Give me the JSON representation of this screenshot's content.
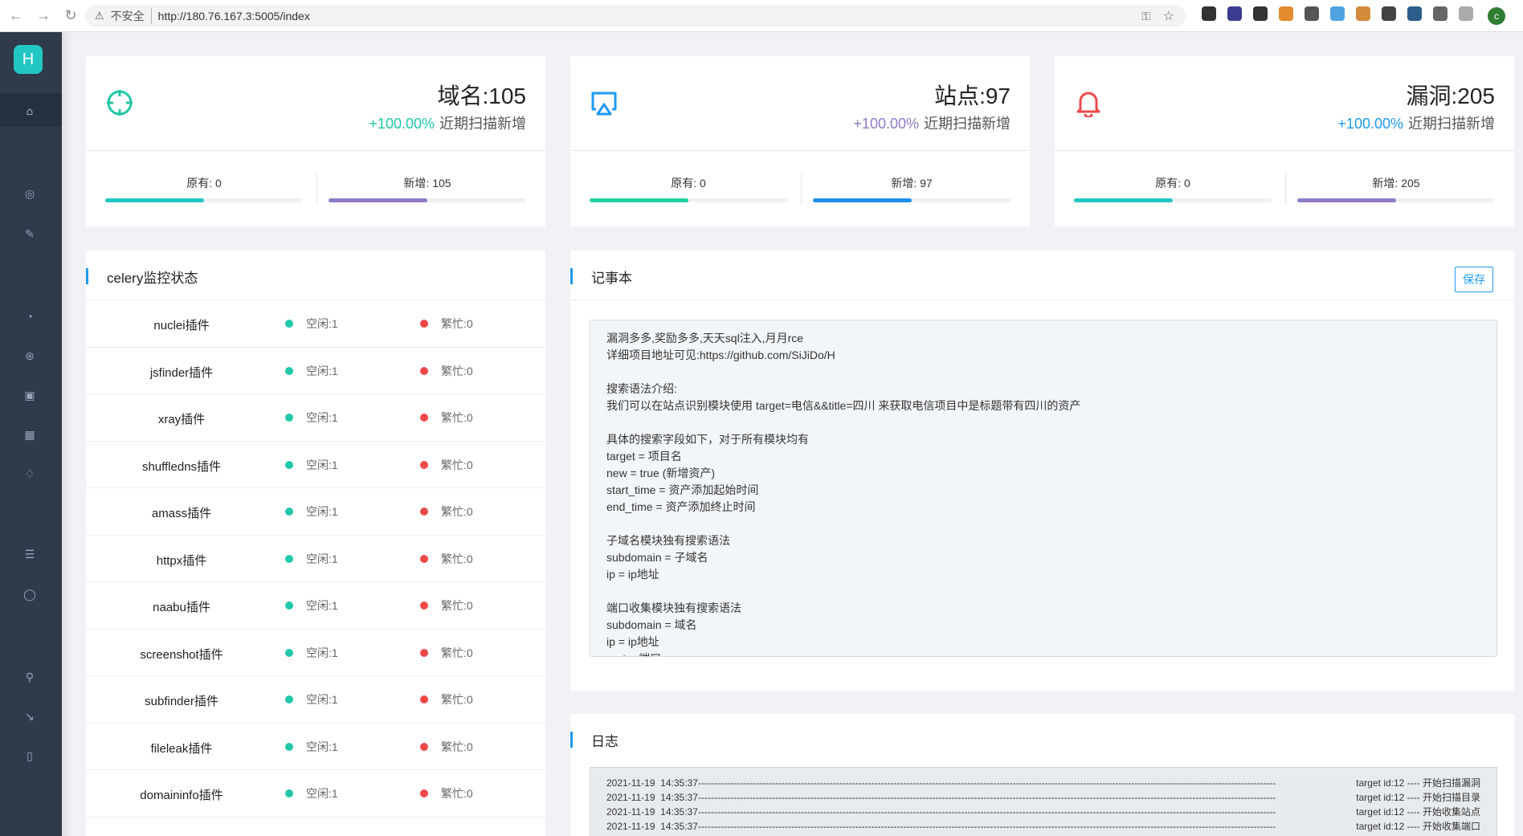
{
  "browser": {
    "insecure_label": "不安全",
    "url": "http://180.76.167.3:5005/index",
    "profile_initial": "c"
  },
  "sidebar": {
    "logo": "H"
  },
  "stats": [
    {
      "title": "域名:105",
      "pct": "+100.00%",
      "sub": "近期扫描新增",
      "orig": "原有: 0",
      "new": "新增: 105",
      "orig_fill": 0.5,
      "new_fill": 0.5,
      "accent": "#22c7a9",
      "pct_color": "#22c7a9",
      "orig_bar": "#22c7c4",
      "new_bar": "#8f7bc6"
    },
    {
      "title": "站点:97",
      "pct": "+100.00%",
      "sub": "近期扫描新增",
      "orig": "原有: 0",
      "new": "新增: 97",
      "orig_fill": 0.5,
      "new_fill": 0.5,
      "accent": "#1d9bf0",
      "pct_color": "#8f7bc6",
      "orig_bar": "#22d3a0",
      "new_bar": "#1d8ff0"
    },
    {
      "title": "漏洞:205",
      "pct": "+100.00%",
      "sub": "近期扫描新增",
      "orig": "原有: 0",
      "new": "新增: 205",
      "orig_fill": 0.5,
      "new_fill": 0.5,
      "accent": "#f04848",
      "pct_color": "#1d9bf0",
      "orig_bar": "#22c7c4",
      "new_bar": "#8f7bc6"
    }
  ],
  "celery": {
    "title": "celery监控状态",
    "rows": [
      {
        "name": "nuclei插件",
        "idle": "空闲:1",
        "busy": "繁忙:0"
      },
      {
        "name": "jsfinder插件",
        "idle": "空闲:1",
        "busy": "繁忙:0"
      },
      {
        "name": "xray插件",
        "idle": "空闲:1",
        "busy": "繁忙:0"
      },
      {
        "name": "shuffledns插件",
        "idle": "空闲:1",
        "busy": "繁忙:0"
      },
      {
        "name": "amass插件",
        "idle": "空闲:1",
        "busy": "繁忙:0"
      },
      {
        "name": "httpx插件",
        "idle": "空闲:1",
        "busy": "繁忙:0"
      },
      {
        "name": "naabu插件",
        "idle": "空闲:1",
        "busy": "繁忙:0"
      },
      {
        "name": "screenshot插件",
        "idle": "空闲:1",
        "busy": "繁忙:0"
      },
      {
        "name": "subfinder插件",
        "idle": "空闲:1",
        "busy": "繁忙:0"
      },
      {
        "name": "fileleak插件",
        "idle": "空闲:1",
        "busy": "繁忙:0"
      },
      {
        "name": "domaininfo插件",
        "idle": "空闲:1",
        "busy": "繁忙:0"
      }
    ]
  },
  "notepad": {
    "title": "记事本",
    "save_label": "保存",
    "lines": [
      "漏洞多多,奖励多多,天天sql注入,月月rce",
      "详细项目地址可见:https://github.com/SiJiDo/H",
      "",
      "搜索语法介绍:",
      "我们可以在站点识别模块使用 target=电信&&title=四川 来获取电信项目中是标题带有四川的资产",
      "",
      "具体的搜索字段如下，对于所有模块均有",
      "target = 项目名",
      "new = true (新增资产)",
      "start_time = 资产添加起始时间",
      "end_time = 资产添加终止时间",
      "",
      "子域名模块独有搜索语法",
      "subdomain = 子域名",
      "ip = ip地址",
      "",
      "端口收集模块独有搜索语法",
      "subdomain = 域名",
      "ip = ip地址",
      "port = 端口"
    ]
  },
  "log": {
    "title": "日志",
    "lines": [
      {
        "time": "2021-11-19  14:35:37",
        "msg": "target id:12 ---- 开始扫描漏洞"
      },
      {
        "time": "2021-11-19  14:35:37",
        "msg": "target id:12 ---- 开始扫描目录"
      },
      {
        "time": "2021-11-19  14:35:37",
        "msg": "target id:12 ---- 开始收集站点"
      },
      {
        "time": "2021-11-19  14:35:37",
        "msg": "target id:12 ---- 开始收集端口"
      }
    ]
  }
}
